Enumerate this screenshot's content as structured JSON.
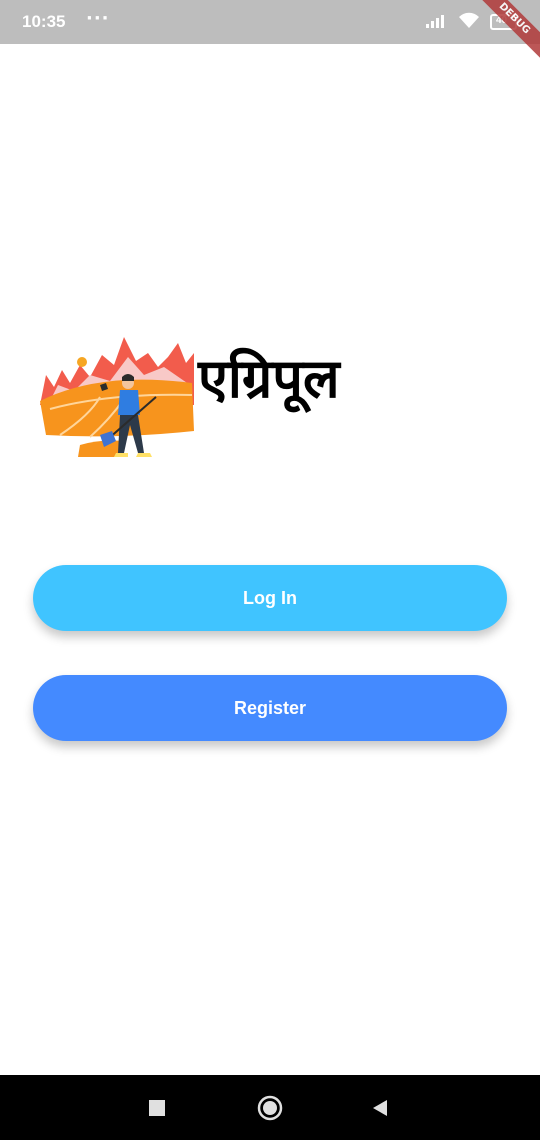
{
  "status_bar": {
    "time": "10:35",
    "dots": "···",
    "debug_label": "DEBUG",
    "battery_level": "40"
  },
  "app": {
    "title": "एग्रिपूल",
    "login_label": "Log In",
    "register_label": "Register"
  },
  "icons": {
    "signal": "signal-icon",
    "wifi": "wifi-icon",
    "battery": "battery-icon",
    "recents": "square-icon",
    "home": "circle-icon",
    "back": "triangle-back-icon"
  },
  "colors": {
    "login_button": "#40c4ff",
    "register_button": "#448aff",
    "status_bar": "#bdbdbd"
  }
}
